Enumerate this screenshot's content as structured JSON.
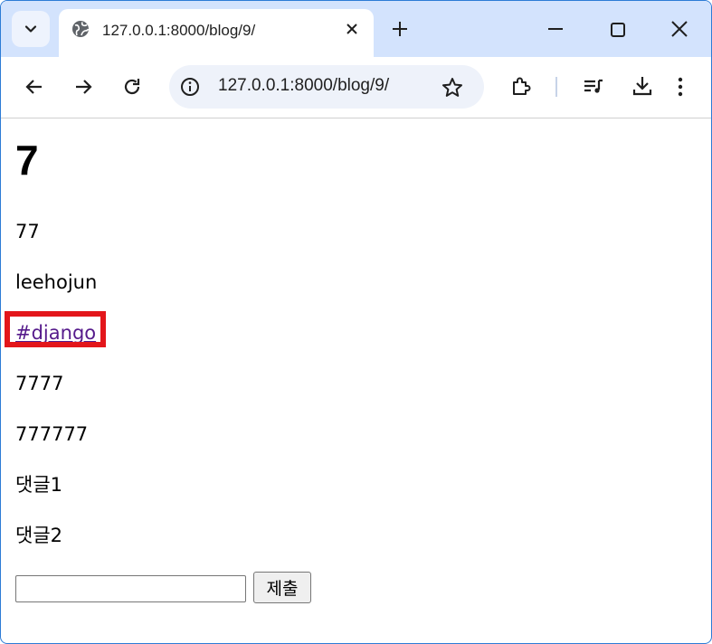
{
  "browser": {
    "tab_title": "127.0.0.1:8000/blog/9/",
    "url": "127.0.0.1:8000/blog/9/",
    "icons": [
      "tab-search-icon",
      "globe-icon",
      "close-icon",
      "plus-icon",
      "minimize-icon",
      "maximize-icon",
      "window-close-icon",
      "back-icon",
      "forward-icon",
      "reload-icon",
      "info-icon",
      "star-icon",
      "extensions-icon",
      "media-icon",
      "download-icon",
      "more-icon"
    ]
  },
  "post": {
    "title": "7",
    "subtitle": "77",
    "author": "leehojun",
    "tag": "#django",
    "content1": "7777",
    "content2": "777777",
    "comments": [
      "댓글1",
      "댓글2"
    ]
  },
  "form": {
    "input_value": "",
    "submit_label": "제출"
  },
  "colors": {
    "tabstrip": "#d3e3fd",
    "link": "#551a8b",
    "highlight": "#e3161b"
  }
}
